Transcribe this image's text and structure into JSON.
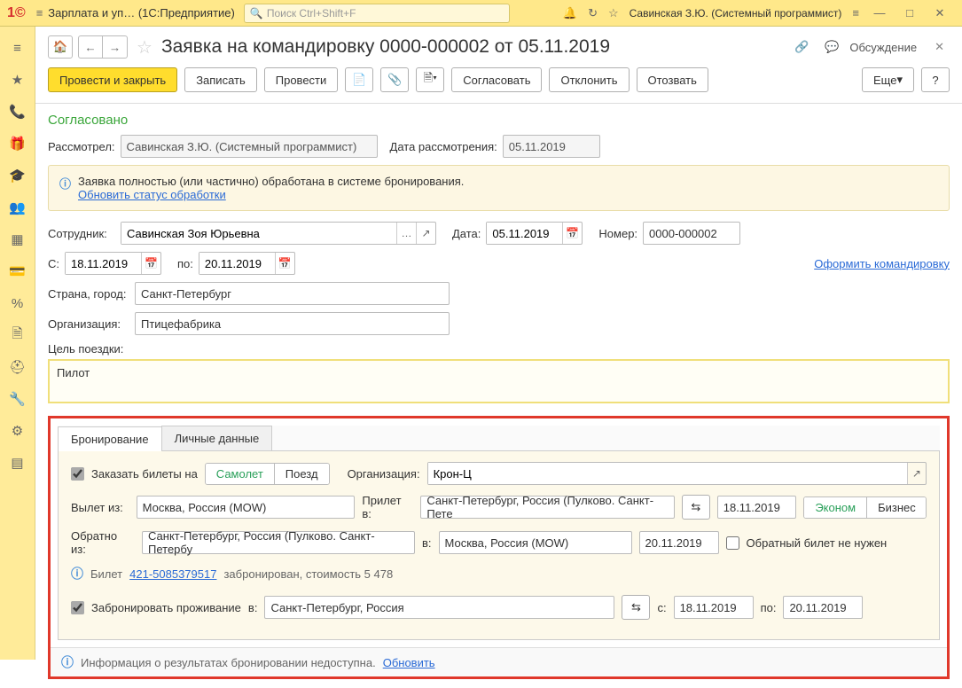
{
  "titlebar": {
    "app_name": "Зарплата и уп…   (1С:Предприятие)",
    "search_placeholder": "Поиск Ctrl+Shift+F",
    "user": "Савинская З.Ю. (Системный программист)"
  },
  "doc": {
    "title": "Заявка на командировку 0000-000002 от 05.11.2019",
    "discussion": "Обсуждение"
  },
  "toolbar": {
    "main_action": "Провести и закрыть",
    "save": "Записать",
    "post": "Провести",
    "approve": "Согласовать",
    "reject": "Отклонить",
    "recall": "Отозвать",
    "more": "Еще"
  },
  "status": {
    "approved": "Согласовано",
    "reviewed_by_label": "Рассмотрел:",
    "reviewed_by": "Савинская З.Ю. (Системный программист)",
    "review_date_label": "Дата рассмотрения:",
    "review_date": "05.11.2019"
  },
  "info_box": {
    "text": "Заявка полностью (или частично) обработана в системе бронирования.",
    "link": "Обновить статус обработки"
  },
  "main_fields": {
    "employee_label": "Сотрудник:",
    "employee": "Савинская Зоя Юрьевна",
    "date_label": "Дата:",
    "date": "05.11.2019",
    "number_label": "Номер:",
    "number": "0000-000002",
    "from_label": "С:",
    "from": "18.11.2019",
    "to_label": "по:",
    "to": "20.11.2019",
    "make_trip_link": "Оформить командировку",
    "country_label": "Страна, город:",
    "country": "Санкт-Петербург",
    "org_label": "Организация:",
    "org": "Птицефабрика",
    "purpose_label": "Цель поездки:",
    "purpose": "Пилот"
  },
  "tabs": {
    "booking": "Бронирование",
    "personal": "Личные данные"
  },
  "booking": {
    "order_tickets_label": "Заказать билеты на",
    "plane": "Самолет",
    "train": "Поезд",
    "booking_org_label": "Организация:",
    "booking_org": "Крон-Ц",
    "dep_from_label": "Вылет из:",
    "dep_from": "Москва, Россия (MOW)",
    "arr_to_label": "Прилет в:",
    "arr_to": "Санкт-Петербург, Россия (Пулково. Санкт-Пете",
    "dep_date": "18.11.2019",
    "economy": "Эконом",
    "business": "Бизнес",
    "ret_from_label": "Обратно из:",
    "ret_from": "Санкт-Петербург, Россия (Пулково. Санкт-Петербу",
    "ret_to_label": "в:",
    "ret_to": "Москва, Россия (MOW)",
    "ret_date": "20.11.2019",
    "no_return_label": "Обратный билет не нужен",
    "ticket_prefix": "Билет",
    "ticket_number": "421-5085379517",
    "ticket_suffix": "забронирован, стоимость 5 478",
    "book_lodging_label": "Забронировать проживание",
    "lodging_in_label": "в:",
    "lodging_city": "Санкт-Петербург, Россия",
    "lodging_from_label": "с:",
    "lodging_from": "18.11.2019",
    "lodging_to_label": "по:",
    "lodging_to": "20.11.2019",
    "info_unavailable": "Информация о результатах бронировании недоступна.",
    "refresh": "Обновить"
  }
}
